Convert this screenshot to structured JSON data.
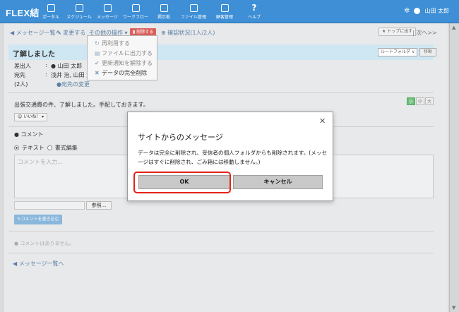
{
  "app": {
    "brand": "FLEX結",
    "user_name": "山田 太郎"
  },
  "nav": [
    {
      "label": "ポータル",
      "icon": "home-icon"
    },
    {
      "label": "スケジュール",
      "icon": "calendar-icon"
    },
    {
      "label": "メッセージ",
      "icon": "envelope-icon"
    },
    {
      "label": "ワークフロー",
      "icon": "document-icon"
    },
    {
      "label": "掲示板",
      "icon": "board-icon"
    },
    {
      "label": "ファイル管理",
      "icon": "folder-icon"
    },
    {
      "label": "顧客管理",
      "icon": "contacts-icon"
    },
    {
      "label": "ヘルプ",
      "icon": "help-icon"
    }
  ],
  "toolbar": {
    "back_link": "メッセージ一覧へ",
    "edit_link": "変更する",
    "other_ops": "その他の操作",
    "delete_label": "削除する",
    "confirm_status": "確認状況(1人/2人)",
    "top_button": "トップに出す",
    "next_link": "次へ>>"
  },
  "dropdown": {
    "items": [
      {
        "label": "再利用する",
        "icon": "recycle-icon",
        "active": false
      },
      {
        "label": "ファイルに出力する",
        "icon": "file-export-icon",
        "active": false
      },
      {
        "label": "更新通知を解除する",
        "icon": "check-icon",
        "active": false
      },
      {
        "label": "データの完全削除",
        "icon": "x-icon",
        "active": true
      }
    ]
  },
  "message": {
    "title": "了解しました",
    "folder_select": "ルートフォルダ",
    "move_button": "移動",
    "sender_label": "差出人",
    "sender_value": "山田 太郎",
    "recipient_label": "宛先",
    "recipient_value": "浅井 治, 山田 太郎",
    "count": "(2人)",
    "recipient_change": "宛先の変更",
    "body": "出張交通費の件、了解しました。手配しておきます。",
    "like_label": "いいね！",
    "sizes": [
      "小",
      "中",
      "大"
    ]
  },
  "comment": {
    "heading": "コメント",
    "mode_text": "テキスト",
    "mode_rich": "書式編集",
    "placeholder": "コメントを入力...",
    "ref_button": "参照...",
    "write_button": "コメントを書き込む",
    "none_text": "コメントはありません。",
    "back_link": "メッセージ一覧へ"
  },
  "dialog": {
    "title": "サイトからのメッセージ",
    "message": "データは完全に削除され、受信者の個人フォルダからも削除されます。(メッセージはすぐに削除され、ごみ箱には移動しません。)",
    "ok": "OK",
    "cancel": "キャンセル"
  }
}
